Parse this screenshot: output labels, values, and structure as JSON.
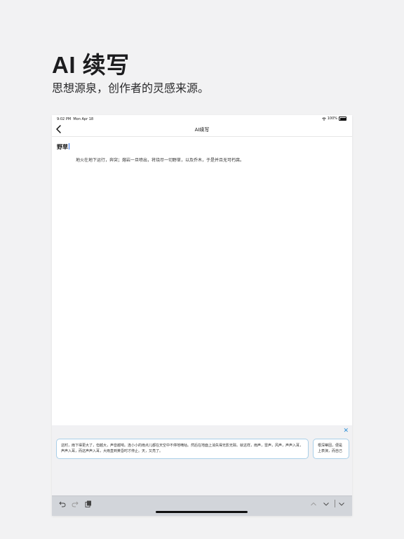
{
  "hero": {
    "title": "AI 续写",
    "subtitle": "思想源泉，创作者的灵感来源。"
  },
  "status_bar": {
    "time": "9:02 PM",
    "date": "Mon Apr 18",
    "battery": "100%"
  },
  "nav": {
    "title": "AI续写",
    "back_icon": "chevron-left-icon"
  },
  "document": {
    "title": "野草",
    "body": "地火在地下运行，奔突；熔岩一旦喷出，将烧尽一切野草，以及乔木，于是并且无可朽腐。"
  },
  "suggestions": {
    "close_icon": "close-icon",
    "items": [
      {
        "text": "这时，雨下得更大了，但越大，声音越响。连小小的雨点儿都在天空中不停地嘀咕。然后在地面上消失得无影无踪。就这样，雨声，雷声，风声，声声入耳，声声入耳，而这声声入耳，大雨直到黄昏时才停止。天，又亮了。"
      },
      {
        "text": "根深蒂固，便是上表演，而自己"
      }
    ]
  },
  "toolbar": {
    "left_icons": [
      "undo-icon",
      "redo-icon",
      "clipboard-icon"
    ],
    "right_icons": [
      "chevron-up-icon",
      "chevron-down-icon",
      "keyboard-dismiss-icon"
    ]
  },
  "colors": {
    "accent": "#2d8fd6",
    "caret": "#2f6fea",
    "card_border": "#a9cfe8",
    "toolbar_bg": "#d2d5da"
  }
}
